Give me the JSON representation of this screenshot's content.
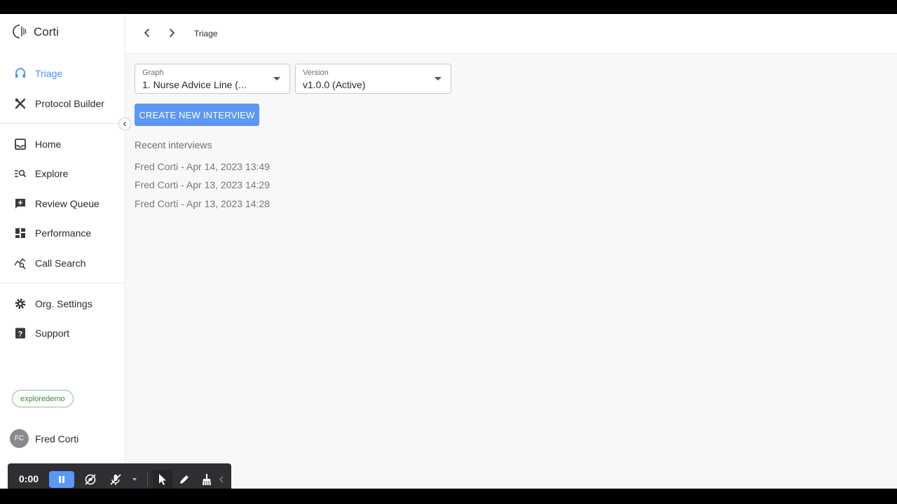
{
  "app": {
    "name": "Corti"
  },
  "sidebar": {
    "primary": [
      {
        "label": "Triage",
        "icon": "headset-icon",
        "active": true
      },
      {
        "label": "Protocol Builder",
        "icon": "tools-icon",
        "active": false
      }
    ],
    "secondary": [
      {
        "label": "Home",
        "icon": "inbox-icon"
      },
      {
        "label": "Explore",
        "icon": "list-search-icon"
      },
      {
        "label": "Review Queue",
        "icon": "add-comment-icon"
      },
      {
        "label": "Performance",
        "icon": "dashboard-icon"
      },
      {
        "label": "Call Search",
        "icon": "chart-search-icon"
      }
    ],
    "tertiary": [
      {
        "label": "Org. Settings",
        "icon": "gear-icon"
      },
      {
        "label": "Support",
        "icon": "help-icon"
      }
    ],
    "org_chip": "exploredemo",
    "user": {
      "initials": "FC",
      "name": "Fred Corti"
    }
  },
  "topbar": {
    "breadcrumb": "Triage"
  },
  "main": {
    "graph_select": {
      "label": "Graph",
      "value": "1. Nurse Advice Line (..."
    },
    "version_select": {
      "label": "Version",
      "value": "v1.0.0 (Active)"
    },
    "create_button": "CREATE NEW INTERVIEW",
    "recent_title": "Recent interviews",
    "recent": [
      "Fred Corti - Apr 14, 2023 13:49",
      "Fred Corti - Apr 13, 2023 14:29",
      "Fred Corti - Apr 13, 2023 14:28"
    ]
  },
  "recorder": {
    "time": "0:00"
  },
  "colors": {
    "accent": "#5d97f5",
    "active_nav": "#4f8ff7",
    "chip_green": "#3d8a3a"
  }
}
